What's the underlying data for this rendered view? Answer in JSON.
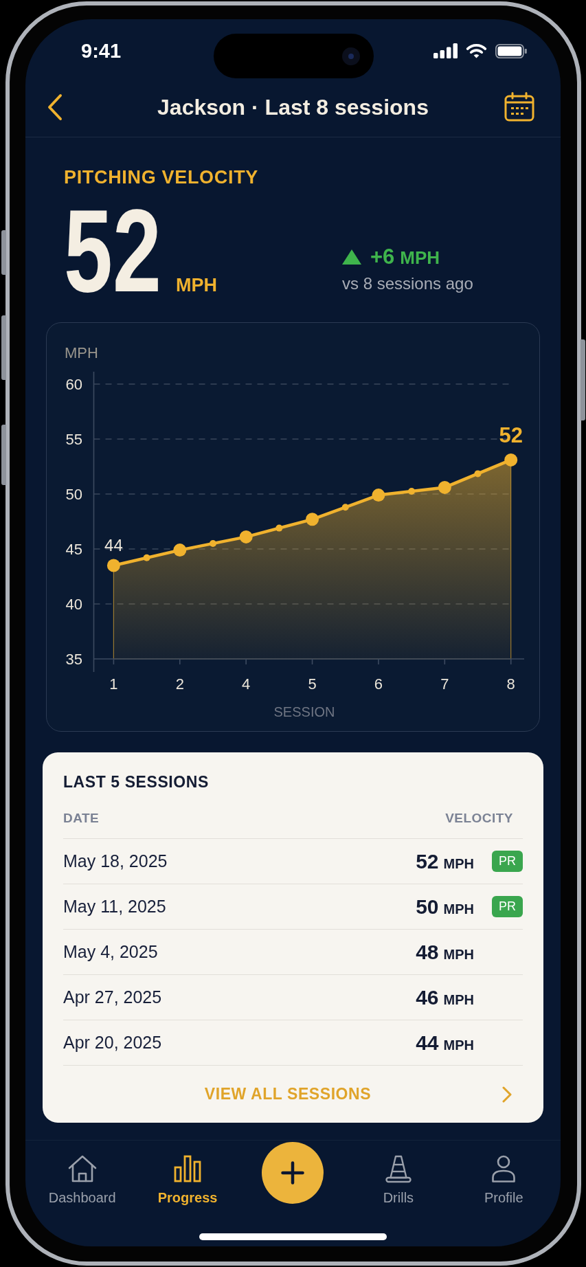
{
  "status_bar": {
    "time": "9:41"
  },
  "header": {
    "title": "Jackson · Last 8 sessions"
  },
  "metric": {
    "label": "PITCHING VELOCITY",
    "value": "52",
    "unit": "MPH",
    "change": {
      "rising": true,
      "amount": "+6",
      "unit": "MPH",
      "caption": "vs 8 sessions ago"
    }
  },
  "chart": {
    "chart_data": {
      "type": "area",
      "xlabel": "SESSION",
      "ylabel": "MPH",
      "categories": [
        "1",
        "2",
        "4",
        "5",
        "6",
        "7",
        "8"
      ],
      "series": [
        {
          "color": "#f0b22e",
          "values": [
            43.5,
            44.9,
            46.1,
            47.7,
            49.9,
            50.6,
            53.1
          ]
        }
      ],
      "ylim": [
        35,
        61
      ],
      "yticks": [
        35,
        40,
        45,
        50,
        55,
        60
      ],
      "grid": true,
      "annotations": [
        {
          "x": "1",
          "y": 43.5,
          "text": "44"
        },
        {
          "x": "8",
          "y": 53.1,
          "text": "52"
        }
      ]
    }
  },
  "sessions": {
    "title": "LAST 5 SESSIONS",
    "columns": [
      "DATE",
      "VELOCITY"
    ],
    "rows": [
      {
        "date": "May 18, 2025",
        "value": "52",
        "unit": "MPH",
        "badge": "PR"
      },
      {
        "date": "May 11, 2025",
        "value": "50",
        "unit": "MPH",
        "badge": "PR"
      },
      {
        "date": "May 4, 2025",
        "value": "48",
        "unit": "MPH"
      },
      {
        "date": "Apr 27, 2025",
        "value": "46",
        "unit": "MPH"
      },
      {
        "date": "Apr 20, 2025",
        "value": "44",
        "unit": "MPH"
      }
    ],
    "footer_link": "VIEW ALL SESSIONS"
  },
  "tab_bar": {
    "items": [
      {
        "kind": "tab",
        "label": "Dashboard",
        "selected": false
      },
      {
        "kind": "tab",
        "label": "Progress",
        "selected": true
      },
      {
        "kind": "action"
      },
      {
        "kind": "tab",
        "label": "Drills",
        "selected": false
      },
      {
        "kind": "tab",
        "label": "Profile",
        "selected": false
      }
    ]
  }
}
